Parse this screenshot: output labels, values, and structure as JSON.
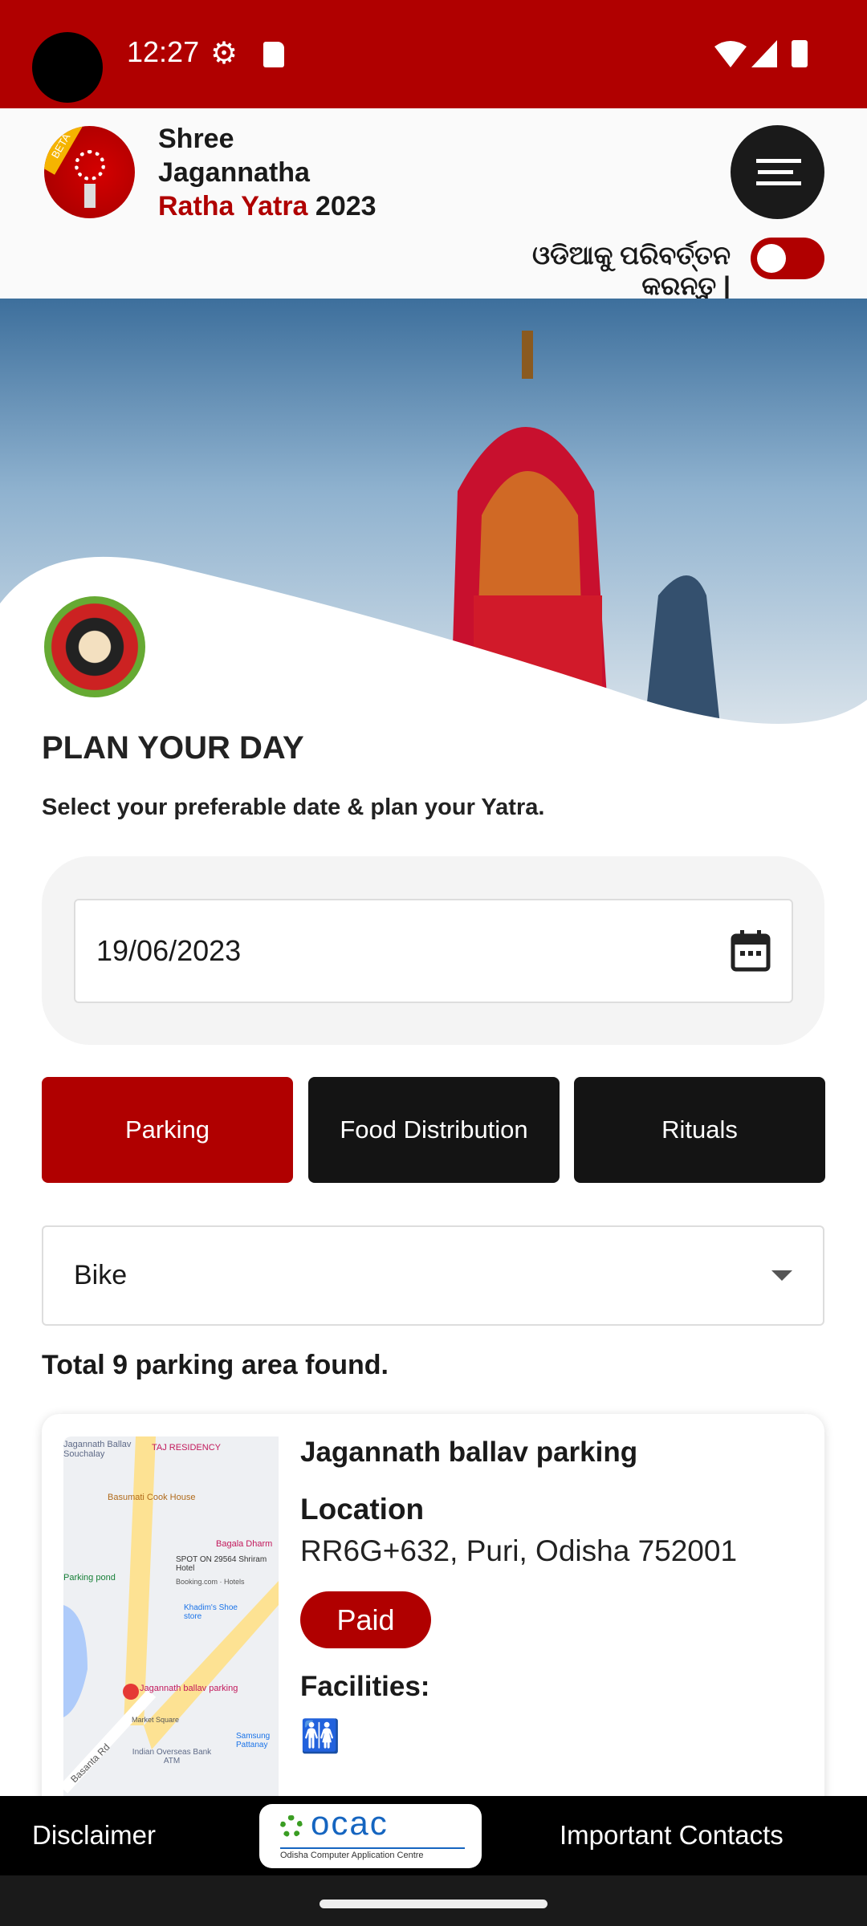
{
  "status_bar": {
    "time": "12:27",
    "icons": [
      "gear-icon",
      "sd-card-icon",
      "wifi-icon",
      "signal-icon",
      "battery-icon"
    ]
  },
  "header": {
    "title_line1": "Shree",
    "title_line2": "Jagannatha",
    "title_red": "Ratha Yatra",
    "title_year": "2023",
    "logo_badge": "BETA",
    "language_toggle_label": "ଓଡିଆକୁ ପରିବର୍ତ୍ତନ କରନ୍ତୁ |",
    "language_toggle_on": false
  },
  "plan": {
    "title": "PLAN YOUR DAY",
    "subtitle": "Select your preferable date & plan your Yatra.",
    "date_value": "19/06/2023"
  },
  "tabs": [
    {
      "label": "Parking",
      "active": true
    },
    {
      "label": "Food Distribution",
      "active": false
    },
    {
      "label": "Rituals",
      "active": false
    }
  ],
  "vehicle_select": {
    "value": "Bike"
  },
  "results": {
    "summary": "Total 9 parking area found."
  },
  "parking_card": {
    "name": "Jagannath ballav parking",
    "location_label": "Location",
    "address": "RR6G+632, Puri, Odisha 752001",
    "fee_badge": "Paid",
    "facilities_label": "Facilities:",
    "facilities": [
      "restroom-icon"
    ],
    "map_labels": [
      "Jagannath Ballav Souchalay",
      "TAJ RESIDENCY",
      "Basumati Cook House",
      "Bagala Dharm",
      "SPOT ON 29564 Shriram Hotel",
      "Booking.com · Hotels",
      "Parking pond",
      "Khadim's Shoe store",
      "Jagannath ballav parking",
      "Market Square",
      "Basanta Rd",
      "Samsung Pattanay",
      "Indian Overseas Bank ATM"
    ]
  },
  "footer": {
    "disclaimer": "Disclaimer",
    "contacts": "Important Contacts",
    "ocac_logo": "ocac",
    "ocac_sub": "Odisha Computer Application Centre"
  },
  "colors": {
    "brand_red": "#b00000",
    "dark": "#141414"
  }
}
